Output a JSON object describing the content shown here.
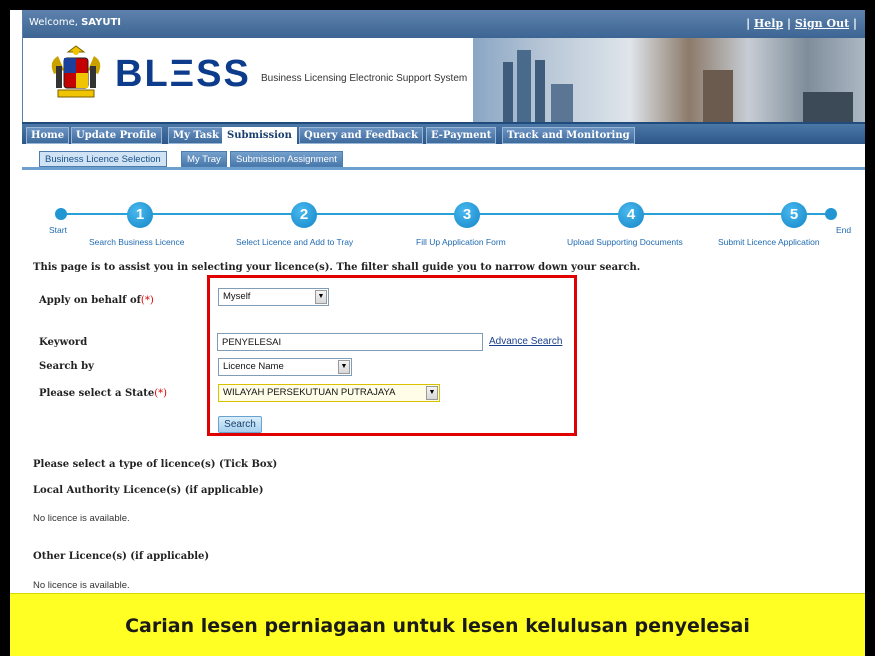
{
  "header": {
    "welcome_prefix": "Welcome, ",
    "user_name": "SAYUTI",
    "help_label": "Help",
    "signout_label": "Sign Out",
    "logo_text": "BLΞSS",
    "tagline": "Business Licensing Electronic Support System"
  },
  "nav": {
    "tabs": [
      "Home",
      "Update Profile",
      "My Task",
      "Submission",
      "Query and Feedback",
      "E-Payment",
      "Track and Monitoring"
    ],
    "active_tab": "Submission"
  },
  "subnav": {
    "tabs": [
      "Business Licence Selection",
      "My Tray",
      "Submission Assignment"
    ],
    "active_tab": "Business Licence Selection"
  },
  "steps": {
    "start_label": "Start",
    "end_label": "End",
    "items": [
      {
        "number": "1",
        "label": "Search Business Licence"
      },
      {
        "number": "2",
        "label": "Select Licence and Add to Tray"
      },
      {
        "number": "3",
        "label": "Fill Up Application Form"
      },
      {
        "number": "4",
        "label": "Upload Supporting Documents"
      },
      {
        "number": "5",
        "label": "Submit Licence Application"
      }
    ]
  },
  "intro": "This page is to assist you in selecting your licence(s). The filter shall guide you to narrow down your search.",
  "form": {
    "behalf_label": "Apply on behalf of",
    "behalf_value": "Myself",
    "keyword_label": "Keyword",
    "keyword_value": "PENYELESAI",
    "advance_search": "Advance Search",
    "searchby_label": "Search by",
    "searchby_value": "Licence Name",
    "state_label": "Please select a State",
    "state_value": "WILAYAH PERSEKUTUAN PUTRAJAYA",
    "required_mark": "(*)",
    "search_button": "Search"
  },
  "results": {
    "type_heading": "Please select a type of licence(s) (Tick Box)",
    "local_heading": "Local Authority Licence(s) (if applicable)",
    "local_empty": "No licence is available.",
    "other_heading": "Other Licence(s) (if applicable)",
    "other_empty": "No licence is available."
  },
  "caption": "Carian lesen perniagaan untuk lesen kelulusan penyelesai",
  "colors": {
    "highlight": "#e00000",
    "caption_bg": "#ffff24",
    "nav_bg": "#2c5788",
    "step_blue": "#1585c7"
  }
}
